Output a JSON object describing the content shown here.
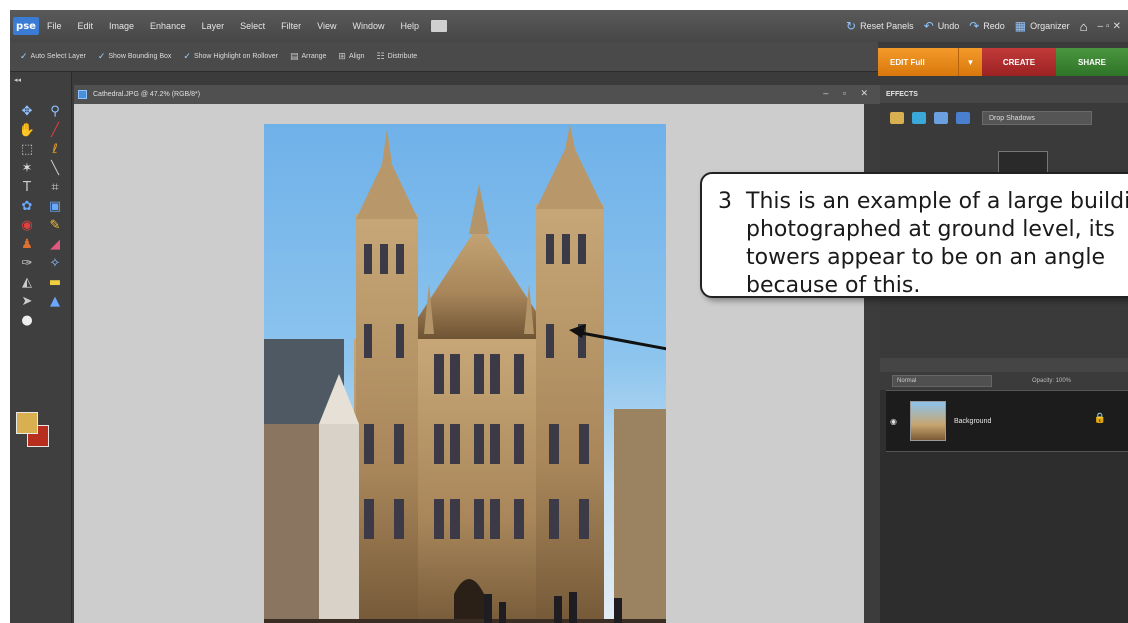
{
  "menubar": {
    "logo": "pse",
    "items": [
      "File",
      "Edit",
      "Image",
      "Enhance",
      "Layer",
      "Select",
      "Filter",
      "View",
      "Window",
      "Help"
    ],
    "reset_panels": "Reset Panels",
    "undo": "Undo",
    "redo": "Redo",
    "organizer": "Organizer"
  },
  "options": {
    "auto_select": "Auto Select Layer",
    "show_bounding": "Show Bounding Box",
    "show_highlight": "Show Highlight on Rollover",
    "arrange": "Arrange",
    "align": "Align",
    "distribute": "Distribute"
  },
  "modes": {
    "edit": "EDIT Full",
    "create": "CREATE",
    "share": "SHARE"
  },
  "document": {
    "title": "Cathedral.JPG @ 47.2% (RGB/8*)"
  },
  "panel": {
    "effects_title": "EFFECTS",
    "effect_dropdown": "Drop Shadows",
    "blend_mode": "Normal",
    "opacity": "Opacity: 100%",
    "layer_name": "Background"
  },
  "callout": {
    "number": "3",
    "text": "This is an example of a large building photographed at ground level, its towers appear to be on an angle because of this."
  },
  "colors": {
    "foreground": "#d9b04f",
    "background": "#b72e1f",
    "accent": "#f39a2a"
  }
}
